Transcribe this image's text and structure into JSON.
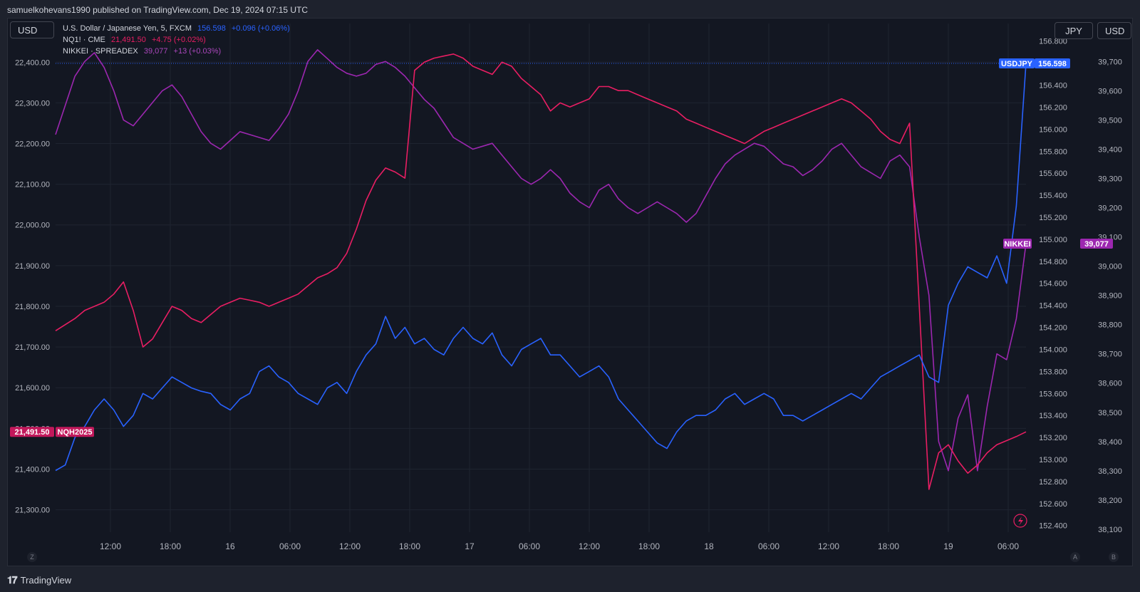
{
  "header": {
    "caption": "samuelkohevans1990 published on TradingView.com, Dec 19, 2024 07:15 UTC"
  },
  "currency_buttons": {
    "left": "USD",
    "right_jpy": "JPY",
    "right_usd": "USD"
  },
  "legend": [
    {
      "name": "U.S. Dollar / Japanese Yen, 5, FXCM",
      "value": "156.598",
      "change": "+0.096 (+0.06%)",
      "color": "#2962ff"
    },
    {
      "name": "NQ1! · CME",
      "value": "21,491.50",
      "change": "+4.75 (+0.02%)",
      "color": "#e91e63"
    },
    {
      "name": "NIKKEI · SPREADEX",
      "value": "39,077",
      "change": "+13 (+0.03%)",
      "color": "#ab47bc"
    }
  ],
  "footer": {
    "brand": "TradingView",
    "logo_glyph": "𝟏𝟕",
    "axis_left_letter": "Z",
    "axis_a_letter": "A",
    "axis_b_letter": "B"
  },
  "colors": {
    "background": "#131722",
    "grid": "#1f2430",
    "usdjpy": "#2962ff",
    "nq": "#d81b60",
    "nikkei": "#9c27b0"
  },
  "chart_data": {
    "type": "line",
    "x_ticks": [
      "12:00",
      "18:00",
      "16",
      "06:00",
      "12:00",
      "18:00",
      "17",
      "06:00",
      "12:00",
      "18:00",
      "18",
      "06:00",
      "12:00",
      "18:00",
      "19",
      "06:00"
    ],
    "left_axis": {
      "series": "NQ1!",
      "ticks": [
        "22,400.00",
        "22,300.00",
        "22,200.00",
        "22,100.00",
        "22,000.00",
        "21,900.00",
        "21,800.00",
        "21,700.00",
        "21,600.00",
        "21,500.00",
        "21,400.00",
        "21,300.00"
      ],
      "range": [
        21245,
        22495
      ]
    },
    "jpy_axis": {
      "series": "USDJPY",
      "ticks": [
        "156.800",
        "156.600",
        "156.400",
        "156.200",
        "156.000",
        "155.800",
        "155.600",
        "155.400",
        "155.200",
        "155.000",
        "154.800",
        "154.600",
        "154.400",
        "154.200",
        "154.000",
        "153.800",
        "153.600",
        "153.400",
        "153.200",
        "153.000",
        "152.800",
        "152.600",
        "152.400"
      ],
      "range": [
        152.34,
        156.96
      ]
    },
    "right_axis": {
      "series": "NIKKEI",
      "ticks": [
        "39,700",
        "39,600",
        "39,500",
        "39,400",
        "39,300",
        "39,200",
        "39,100",
        "39,000",
        "38,900",
        "38,800",
        "38,700",
        "38,600",
        "38,500",
        "38,400",
        "38,300",
        "38,200",
        "38,100"
      ],
      "range": [
        38090,
        39830
      ]
    },
    "series": [
      {
        "name": "USDJPY",
        "color": "#2962ff",
        "last_label": "USDJPY",
        "last_value": "156.598",
        "x": [
          0,
          1,
          2,
          3,
          4,
          5,
          6,
          7,
          8,
          9,
          10,
          11,
          12,
          13,
          14,
          15,
          16,
          17,
          18,
          19,
          20,
          21,
          22,
          23,
          24,
          25,
          26,
          27,
          28,
          29,
          30,
          31,
          32,
          33,
          34,
          35,
          36,
          37,
          38,
          39,
          40,
          41,
          42,
          43,
          44,
          45,
          46,
          47,
          48,
          49,
          50,
          51,
          52,
          53,
          54,
          55,
          56,
          57,
          58,
          59,
          60,
          61,
          62,
          63,
          64,
          65,
          66,
          67,
          68,
          69,
          70,
          71,
          72,
          73,
          74,
          75,
          76,
          77,
          78,
          79,
          80,
          81,
          82,
          83,
          84,
          85,
          86,
          87,
          88,
          89,
          90,
          91,
          92,
          93,
          94,
          95,
          96,
          97,
          98,
          99,
          100
        ],
        "values": [
          152.9,
          152.95,
          153.2,
          153.3,
          153.45,
          153.55,
          153.45,
          153.3,
          153.4,
          153.6,
          153.55,
          153.65,
          153.75,
          153.7,
          153.65,
          153.62,
          153.6,
          153.5,
          153.45,
          153.55,
          153.6,
          153.8,
          153.85,
          153.75,
          153.7,
          153.6,
          153.55,
          153.5,
          153.65,
          153.7,
          153.6,
          153.8,
          153.95,
          154.05,
          154.3,
          154.1,
          154.2,
          154.05,
          154.1,
          154.0,
          153.95,
          154.1,
          154.2,
          154.1,
          154.05,
          154.15,
          153.95,
          153.85,
          154.0,
          154.05,
          154.1,
          153.95,
          153.95,
          153.85,
          153.75,
          153.8,
          153.85,
          153.75,
          153.55,
          153.45,
          153.35,
          153.25,
          153.15,
          153.1,
          153.25,
          153.35,
          153.4,
          153.4,
          153.45,
          153.55,
          153.6,
          153.5,
          153.55,
          153.6,
          153.55,
          153.4,
          153.4,
          153.35,
          153.4,
          153.45,
          153.5,
          153.55,
          153.6,
          153.55,
          153.65,
          153.75,
          153.8,
          153.85,
          153.9,
          153.95,
          153.75,
          153.7,
          154.4,
          154.6,
          154.75,
          154.7,
          154.65,
          154.85,
          154.6,
          155.3,
          156.598
        ]
      },
      {
        "name": "NQ1!",
        "color": "#e91e63",
        "last_label": "NQH2025",
        "last_value": "21,491.50",
        "x": [
          0,
          1,
          2,
          3,
          4,
          5,
          6,
          7,
          8,
          9,
          10,
          11,
          12,
          13,
          14,
          15,
          16,
          17,
          18,
          19,
          20,
          21,
          22,
          23,
          24,
          25,
          26,
          27,
          28,
          29,
          30,
          31,
          32,
          33,
          34,
          35,
          36,
          37,
          38,
          39,
          40,
          41,
          42,
          43,
          44,
          45,
          46,
          47,
          48,
          49,
          50,
          51,
          52,
          53,
          54,
          55,
          56,
          57,
          58,
          59,
          60,
          61,
          62,
          63,
          64,
          65,
          66,
          67,
          68,
          69,
          70,
          71,
          72,
          73,
          74,
          75,
          76,
          77,
          78,
          79,
          80,
          81,
          82,
          83,
          84,
          85,
          86,
          87,
          88,
          89,
          90,
          91,
          92,
          93,
          94,
          95,
          96,
          97,
          98,
          99,
          100
        ],
        "values": [
          21740,
          21755,
          21770,
          21790,
          21800,
          21810,
          21830,
          21860,
          21790,
          21700,
          21720,
          21760,
          21800,
          21790,
          21770,
          21760,
          21780,
          21800,
          21810,
          21820,
          21815,
          21810,
          21800,
          21810,
          21820,
          21830,
          21850,
          21870,
          21880,
          21895,
          21930,
          21990,
          22060,
          22110,
          22140,
          22130,
          22115,
          22380,
          22400,
          22410,
          22415,
          22420,
          22410,
          22390,
          22380,
          22370,
          22400,
          22390,
          22360,
          22340,
          22320,
          22280,
          22300,
          22290,
          22300,
          22310,
          22340,
          22340,
          22330,
          22330,
          22320,
          22310,
          22300,
          22290,
          22280,
          22260,
          22250,
          22240,
          22230,
          22220,
          22210,
          22200,
          22215,
          22230,
          22240,
          22250,
          22260,
          22270,
          22280,
          22290,
          22300,
          22310,
          22300,
          22280,
          22260,
          22230,
          22210,
          22200,
          22250,
          21800,
          21350,
          21440,
          21460,
          21420,
          21390,
          21410,
          21440,
          21460,
          21470,
          21480,
          21491.5
        ]
      },
      {
        "name": "NIKKEI",
        "color": "#9c27b0",
        "last_label": "NIKKEI",
        "last_value": "39,077",
        "x": [
          0,
          1,
          2,
          3,
          4,
          5,
          6,
          7,
          8,
          9,
          10,
          11,
          12,
          13,
          14,
          15,
          16,
          17,
          18,
          19,
          20,
          21,
          22,
          23,
          24,
          25,
          26,
          27,
          28,
          29,
          30,
          31,
          32,
          33,
          34,
          35,
          36,
          37,
          38,
          39,
          40,
          41,
          42,
          43,
          44,
          45,
          46,
          47,
          48,
          49,
          50,
          51,
          52,
          53,
          54,
          55,
          56,
          57,
          58,
          59,
          60,
          61,
          62,
          63,
          64,
          65,
          66,
          67,
          68,
          69,
          70,
          71,
          72,
          73,
          74,
          75,
          76,
          77,
          78,
          79,
          80,
          81,
          82,
          83,
          84,
          85,
          86,
          87,
          88,
          89,
          90,
          91,
          92,
          93,
          94,
          95,
          96,
          97,
          98,
          99,
          100
        ],
        "values": [
          39450,
          39550,
          39650,
          39700,
          39730,
          39680,
          39600,
          39500,
          39480,
          39520,
          39560,
          39600,
          39620,
          39580,
          39520,
          39460,
          39420,
          39400,
          39430,
          39460,
          39450,
          39440,
          39430,
          39470,
          39520,
          39600,
          39700,
          39740,
          39710,
          39680,
          39660,
          39650,
          39660,
          39690,
          39700,
          39680,
          39650,
          39610,
          39570,
          39540,
          39490,
          39440,
          39420,
          39400,
          39410,
          39420,
          39380,
          39340,
          39300,
          39280,
          39300,
          39330,
          39300,
          39250,
          39220,
          39200,
          39260,
          39280,
          39230,
          39200,
          39180,
          39200,
          39220,
          39200,
          39180,
          39150,
          39180,
          39240,
          39300,
          39350,
          39380,
          39400,
          39420,
          39410,
          39380,
          39350,
          39340,
          39310,
          39330,
          39360,
          39400,
          39420,
          39380,
          39340,
          39320,
          39300,
          39360,
          39380,
          39340,
          39100,
          38900,
          38400,
          38300,
          38480,
          38560,
          38300,
          38520,
          38700,
          38680,
          38820,
          39077
        ]
      }
    ]
  }
}
